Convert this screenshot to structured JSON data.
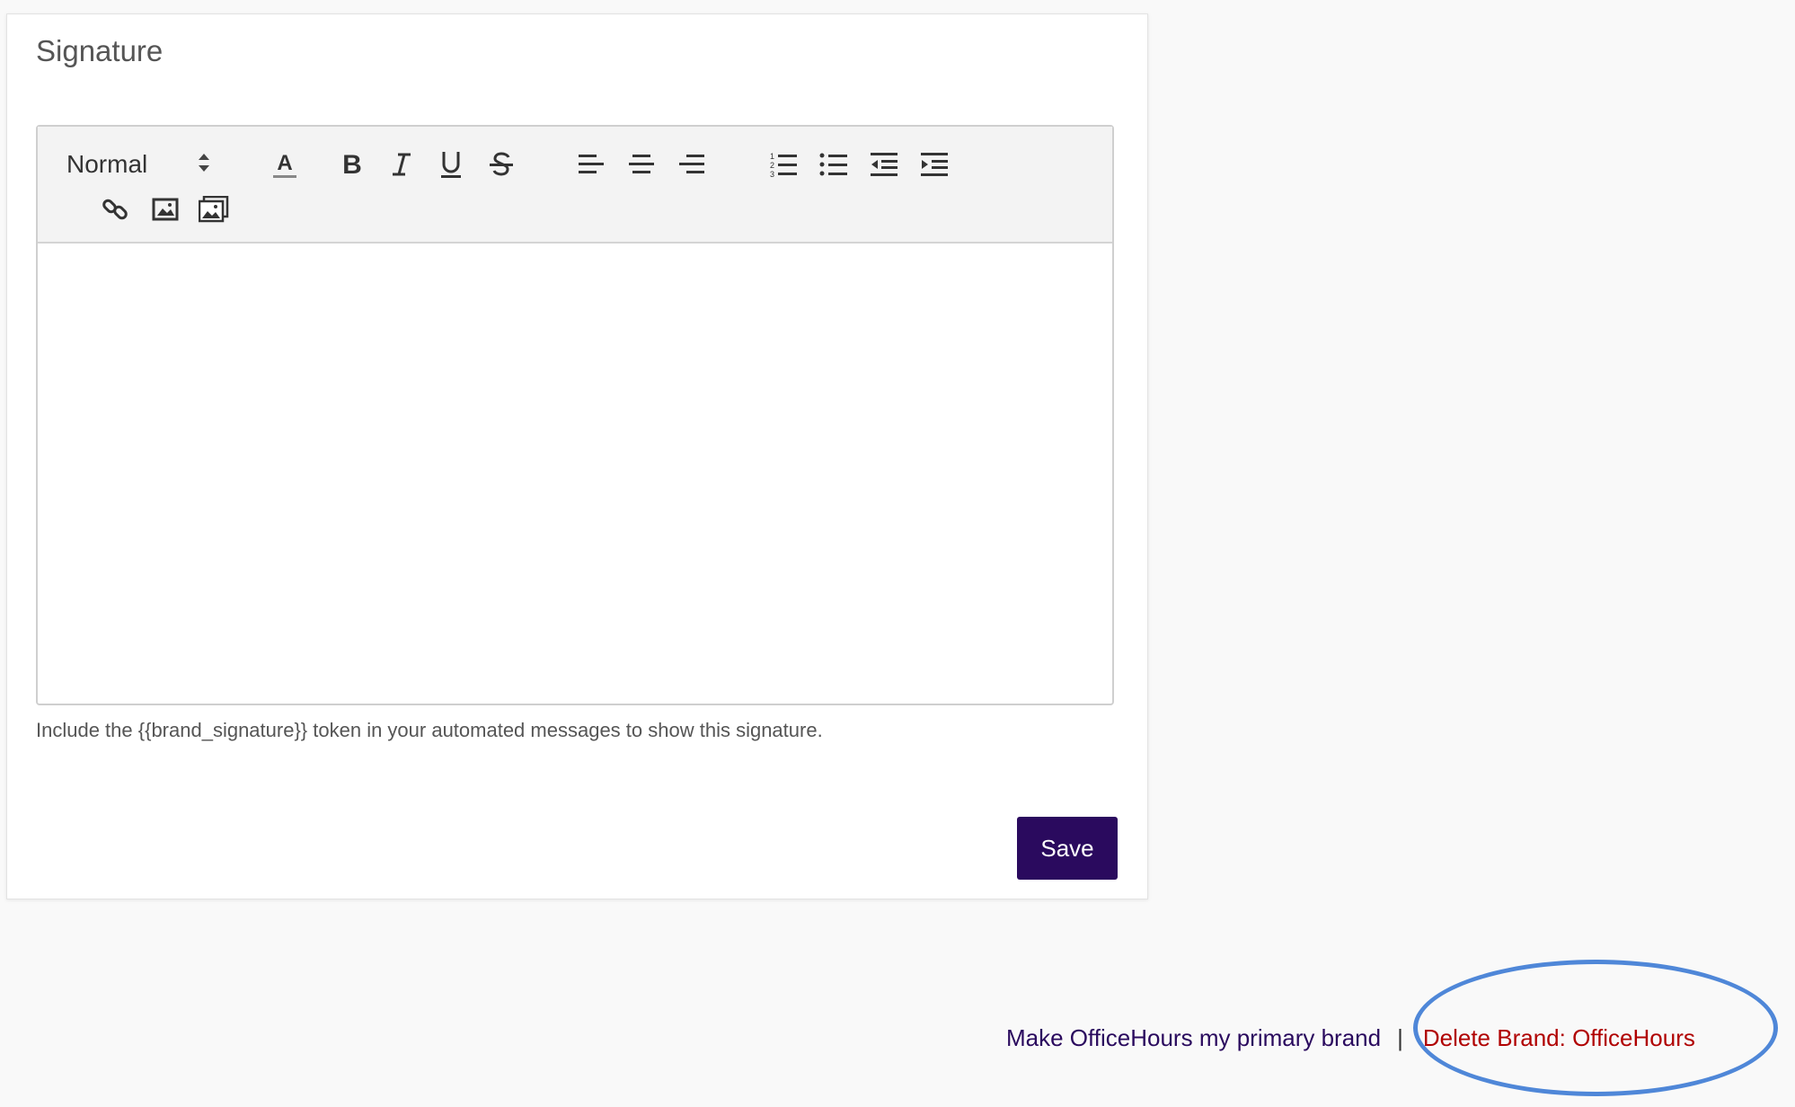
{
  "card": {
    "title": "Signature"
  },
  "editor": {
    "format_value": "Normal",
    "toolbar_icons": [
      "text-color-icon",
      "bold-icon",
      "italic-icon",
      "underline-icon",
      "strikethrough-icon",
      "align-left-icon",
      "align-center-icon",
      "align-right-icon",
      "ordered-list-icon",
      "bullet-list-icon",
      "outdent-icon",
      "indent-icon",
      "link-icon",
      "image-icon",
      "gallery-icon"
    ],
    "content": ""
  },
  "hint_text": "Include the {{brand_signature}} token in your automated messages to show this signature.",
  "save_label": "Save",
  "footer": {
    "primary_link": "Make OfficeHours my primary brand",
    "separator": "|",
    "delete_link": "Delete Brand: OfficeHours"
  },
  "colors": {
    "save_button": "#2a0a5e",
    "primary_link": "#2a0a5e",
    "delete_link": "#b00000",
    "highlight_ring": "#4f87d8"
  }
}
